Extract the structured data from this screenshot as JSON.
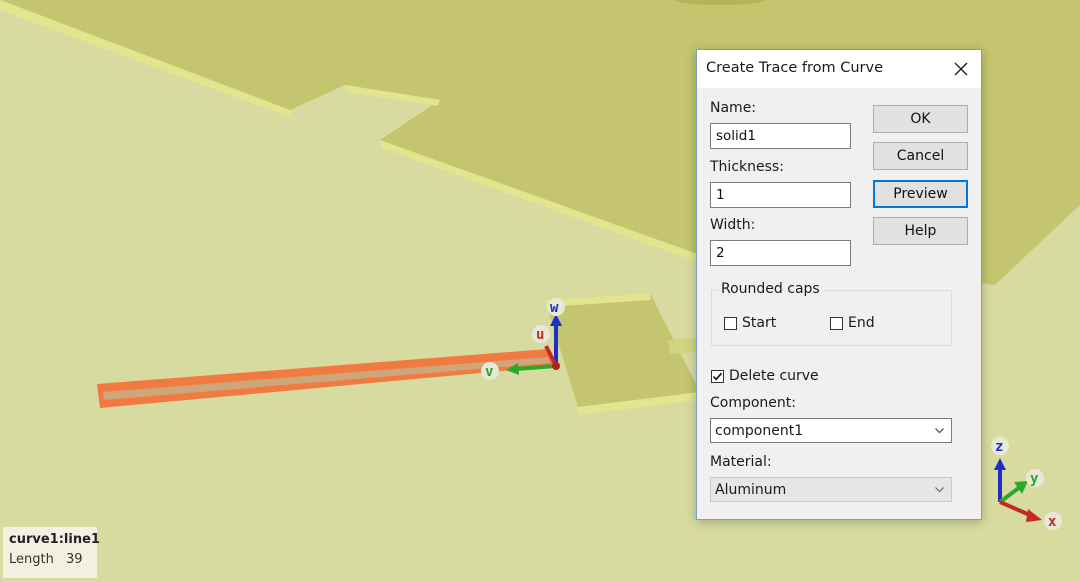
{
  "scene": {
    "colors": {
      "background": "#d8dba0",
      "board": "#c4c56e",
      "trace": "#f07a42"
    },
    "triad_small": {
      "u": "u",
      "v": "v",
      "w": "w"
    },
    "triad_corner": {
      "x": "x",
      "y": "y",
      "z": "z"
    }
  },
  "dialog": {
    "title": "Create Trace from Curve",
    "close_icon": "close-icon",
    "name_label": "Name:",
    "name_value": "solid1",
    "thickness_label": "Thickness:",
    "thickness_value": "1",
    "width_label": "Width:",
    "width_value": "2",
    "buttons": {
      "ok": "OK",
      "cancel": "Cancel",
      "preview": "Preview",
      "help": "Help"
    },
    "rounded_caps": {
      "label": "Rounded caps",
      "start_label": "Start",
      "start_checked": false,
      "end_label": "End",
      "end_checked": false
    },
    "delete_curve_label": "Delete curve",
    "delete_curve_checked": true,
    "component_label": "Component:",
    "component_value": "component1",
    "material_label": "Material:",
    "material_value": "Aluminum"
  },
  "info": {
    "name": "curve1:line1",
    "length_label": "Length",
    "length_value": "39"
  }
}
